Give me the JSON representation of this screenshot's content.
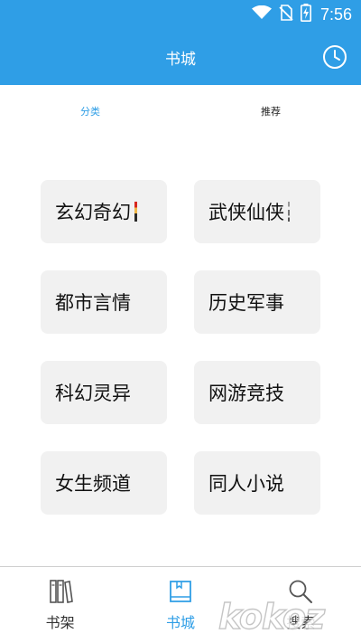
{
  "status_bar": {
    "time": "7:56",
    "icons": [
      "wifi-icon",
      "no-sim-icon",
      "battery-charging-icon"
    ]
  },
  "app_bar": {
    "title": "书城",
    "history_icon": "clock-icon"
  },
  "tabs": [
    {
      "label": "分类",
      "active": true
    },
    {
      "label": "推荐",
      "active": false
    }
  ],
  "categories": [
    {
      "label": "玄幻奇幻"
    },
    {
      "label": "武侠仙侠"
    },
    {
      "label": "都市言情"
    },
    {
      "label": "历史军事"
    },
    {
      "label": "科幻灵异"
    },
    {
      "label": "网游竞技"
    },
    {
      "label": "女生频道"
    },
    {
      "label": "同人小说"
    }
  ],
  "bottom_nav": [
    {
      "label": "书架",
      "icon": "bookshelf-icon",
      "active": false
    },
    {
      "label": "书城",
      "icon": "book-icon",
      "active": true
    },
    {
      "label": "搜索",
      "icon": "search-icon",
      "active": false
    }
  ],
  "watermark": {
    "text": "kokoz"
  },
  "colors": {
    "primary": "#2f9ee6",
    "card_bg": "#f1f1f1",
    "text": "#111111"
  }
}
